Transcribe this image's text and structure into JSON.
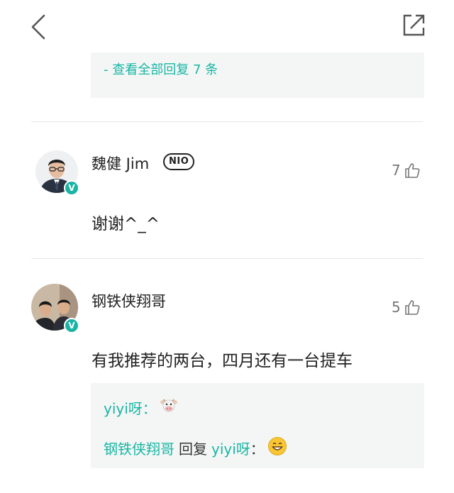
{
  "header": {
    "back_icon": "chevron-left-icon",
    "share_icon": "share-icon"
  },
  "top_reply": {
    "view_all": "- 查看全部回复 7 条"
  },
  "comments": [
    {
      "username": "魏健 Jim",
      "badge": "NIO",
      "likes": "7",
      "text": "谢谢^_^"
    },
    {
      "username": "钢铁侠翔哥",
      "likes": "5",
      "text": "有我推荐的两台，四月还有一台提车"
    }
  ],
  "sub_replies": [
    {
      "author": "yiyi呀",
      "sep": "：",
      "emoji": "cow-emoji"
    },
    {
      "author": "钢铁侠翔哥",
      "action": "回复",
      "target": "yiyi呀",
      "sep": "：",
      "emoji": "smile-emoji"
    }
  ],
  "colors": {
    "accent": "#19b6a3",
    "badge": "#1ab4a4"
  }
}
